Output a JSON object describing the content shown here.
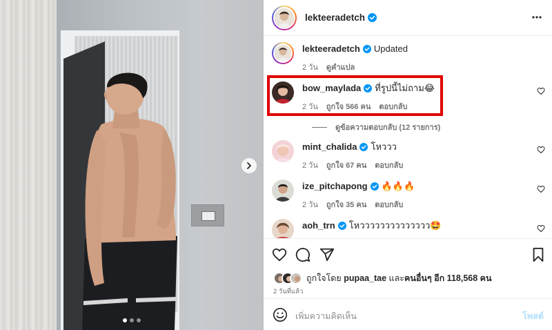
{
  "post": {
    "author": "lekteeradetch",
    "carousel_dots": 3,
    "carousel_active": 1
  },
  "caption": {
    "username": "lekteeradetch",
    "text": "Updated",
    "time": "2 วัน",
    "translate": "ดูคำแปล"
  },
  "comments": [
    {
      "username": "bow_maylada",
      "text": "ที่รูปนี้ไม่ถาม😂",
      "time": "2 วัน",
      "likes": "ถูกใจ 566 คน",
      "reply": "ตอบกลับ"
    },
    {
      "username": "mint_chalida",
      "text": "โหววว",
      "time": "2 วัน",
      "likes": "ถูกใจ 67 คน",
      "reply": "ตอบกลับ"
    },
    {
      "username": "ize_pitchapong",
      "text": "🔥🔥🔥",
      "time": "2 วัน",
      "likes": "ถูกใจ 35 คน",
      "reply": "ตอบกลับ"
    },
    {
      "username": "aoh_trn",
      "text": "โหวววววววววววววว🤩"
    }
  ],
  "replies_link": "ดูข้อความตอบกลับ (12 รายการ)",
  "likes": {
    "prefix": "ถูกใจโดย",
    "user": "pupaa_tae",
    "connector": "และ",
    "others": "คนอื่นๆ อีก 118,568 คน"
  },
  "post_time": "2 วันที่แล้ว",
  "composer": {
    "placeholder": "เพิ่มความคิดเห็น",
    "post_label": "โพสต์"
  },
  "colors": {
    "verified": "#0095f6",
    "highlight": "#e00000",
    "post_disabled": "#b2dffc"
  }
}
